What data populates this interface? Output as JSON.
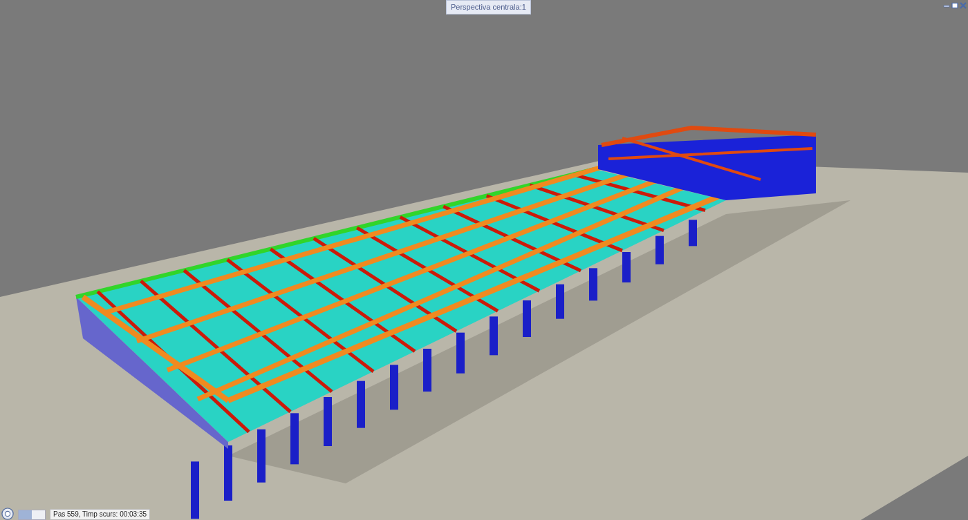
{
  "viewport": {
    "title": "Perspectiva centrala:1"
  },
  "status_bar": {
    "progress": {
      "level": 0.5
    },
    "text": "Pas 559, Timp scurs: 00:03:35"
  }
}
